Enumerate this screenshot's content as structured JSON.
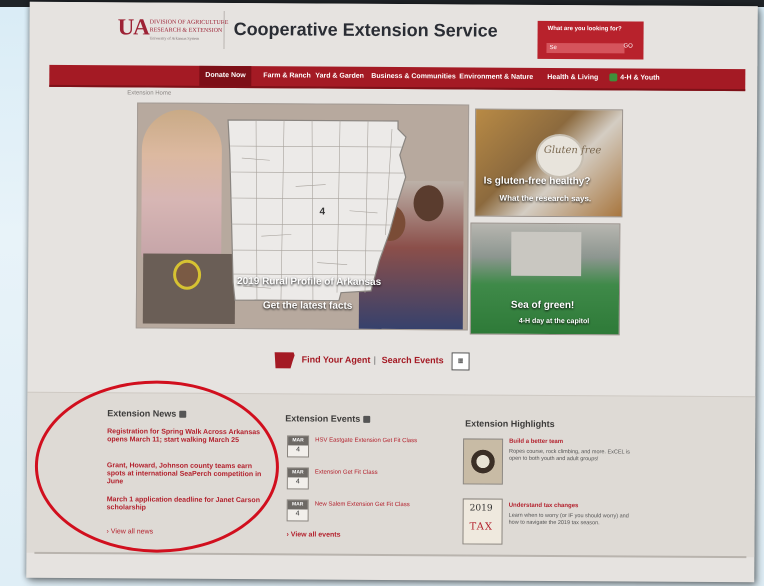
{
  "header": {
    "logo_mark": "UA",
    "logo_line1": "DIVISION OF AGRICULTURE",
    "logo_line2": "RESEARCH & EXTENSION",
    "logo_line3": "University of Arkansas System",
    "site_title": "Cooperative Extension Service",
    "search_label": "What are you looking for?",
    "search_value": "Se",
    "search_button": "GO"
  },
  "nav": {
    "donate": "Donate Now",
    "items": [
      "Farm & Ranch",
      "Yard & Garden",
      "Business & Communities",
      "Environment & Nature",
      "Health & Living",
      "4-H & Youth"
    ]
  },
  "breadcrumb": "Extension Home",
  "hero": {
    "line1": "2019 Rural Profile of Arkansas",
    "line2": "Get the latest facts"
  },
  "cards": {
    "gluten": {
      "script": "Gluten free",
      "title": "Is gluten-free healthy?",
      "subtitle": "What the research says."
    },
    "fourh": {
      "title": "Sea of green!",
      "subtitle": "4-H day at the capitol"
    }
  },
  "quick_links": {
    "find_agent": "Find Your Agent",
    "separator": "|",
    "search_events": "Search Events"
  },
  "news": {
    "title": "Extension News",
    "items": [
      "Registration for Spring Walk Across Arkansas opens March 11; start walking March 25",
      "Grant, Howard, Johnson county teams earn spots at international SeaPerch competition in June",
      "March 1 application deadline for Janet Carson scholarship"
    ],
    "view_all": "View all news"
  },
  "events": {
    "title": "Extension Events",
    "items": [
      {
        "month": "MAR",
        "day": "4",
        "title": "HSV Eastgate Extension Get Fit Class"
      },
      {
        "month": "MAR",
        "day": "4",
        "title": "Extension Get Fit Class"
      },
      {
        "month": "MAR",
        "day": "4",
        "title": "New Salem Extension Get Fit Class"
      }
    ],
    "view_all": "View all events"
  },
  "highlights": {
    "title": "Extension Highlights",
    "items": [
      {
        "heading": "Build a better team",
        "desc": "Ropes course, rock climbing, and more. ExCEL is open to both youth and adult groups!"
      },
      {
        "heading": "Understand tax changes",
        "desc": "Learn when to worry (or IF you should worry) and how to navigate the 2019 tax season."
      }
    ],
    "tax_year": "2019",
    "tax_word": "TAX"
  },
  "colors": {
    "brand_red": "#a41a24",
    "annotation_red": "#d10f1e"
  }
}
